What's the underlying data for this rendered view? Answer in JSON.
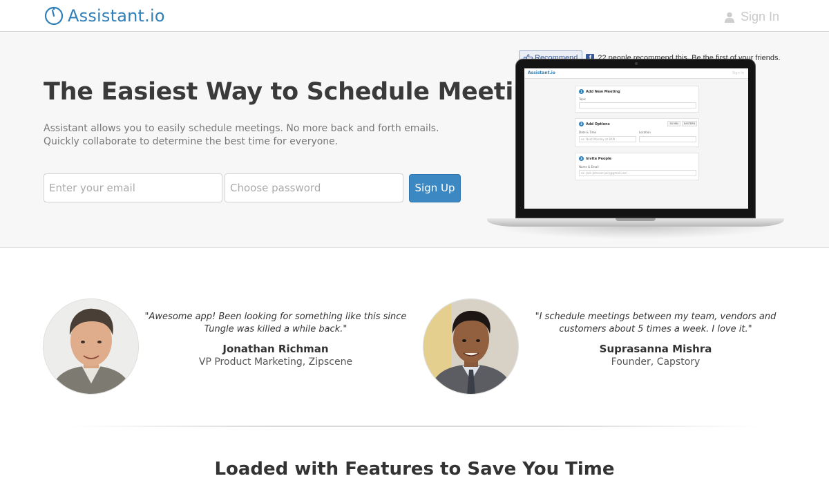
{
  "header": {
    "logo_text": "Assistant.io",
    "signin_label": "Sign In"
  },
  "social": {
    "recommend_label": "Recommend",
    "recommend_text": "22 people recommend this. Be the first of your friends."
  },
  "hero": {
    "title": "The Easiest Way to Schedule Meetings",
    "subtitle": "Assistant allows you to easily schedule meetings. No more back and forth emails. Quickly collaborate to determine the best time for everyone.",
    "email_placeholder": "Enter your email",
    "password_placeholder": "Choose password",
    "signup_label": "Sign Up"
  },
  "screen_preview": {
    "logo": "Assistant.io",
    "signin": "Sign In",
    "step1_num": "1",
    "step1_title": "Add New Meeting",
    "step1_label": "Topic",
    "step2_num": "2",
    "step2_title": "Add Options",
    "step2_pill1": "30 MIN",
    "step2_pill2": "EASTERN",
    "step2_label_date": "Date & Time",
    "step2_label_loc": "Location",
    "step2_date_ph": "ex: Next Monday at 8AM",
    "step3_num": "3",
    "step3_title": "Invite People",
    "step3_label": "Name & Email",
    "step3_ph": "ex: Jack Johnson jack@gmail.com"
  },
  "testimonials": [
    {
      "quote": "\"Awesome app! Been looking for something like this since Tungle was killed a while back.\"",
      "name": "Jonathan Richman",
      "role": "VP Product Marketing, Zipscene"
    },
    {
      "quote": "\"I schedule meetings between my team, vendors and customers about 5 times a week. I love it.\"",
      "name": "Suprasanna Mishra",
      "role": "Founder, Capstory"
    }
  ],
  "features": {
    "title": "Loaded with Features to Save You Time"
  },
  "colors": {
    "brand": "#2f7fb8",
    "button": "#3b88c3",
    "facebook": "#3b5998"
  }
}
